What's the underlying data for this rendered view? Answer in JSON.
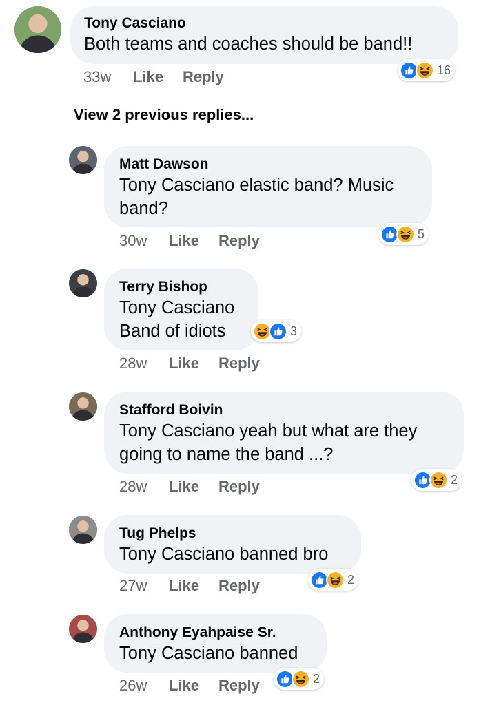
{
  "main_comment": {
    "author": "Tony Casciano",
    "text": "Both teams and coaches should be band!!",
    "time": "33w",
    "like_label": "Like",
    "reply_label": "Reply",
    "reaction_count": "16"
  },
  "view_previous": "View 2 previous replies...",
  "replies": [
    {
      "author": "Matt Dawson",
      "line1": "Tony Casciano elastic band? Music",
      "line2": "band?",
      "time": "30w",
      "like_label": "Like",
      "reply_label": "Reply",
      "reaction_count": "5"
    },
    {
      "author": "Terry Bishop",
      "line1": "Tony Casciano",
      "line2": "Band of idiots",
      "time": "28w",
      "like_label": "Like",
      "reply_label": "Reply",
      "reaction_count": "3"
    },
    {
      "author": "Stafford Boivin",
      "line1": "Tony Casciano  yeah but what are they",
      "line2": "going to name the band ...?",
      "time": "28w",
      "like_label": "Like",
      "reply_label": "Reply",
      "reaction_count": "2"
    },
    {
      "author": "Tug Phelps",
      "line1": "Tony Casciano banned bro",
      "time": "27w",
      "like_label": "Like",
      "reply_label": "Reply",
      "reaction_count": "2"
    },
    {
      "author": "Anthony Eyahpaise Sr.",
      "line1": "Tony Casciano banned",
      "time": "26w",
      "like_label": "Like",
      "reply_label": "Reply",
      "reaction_count": "2"
    }
  ],
  "colors": {
    "bubble": "#f0f2f5",
    "meta_text": "#65676b",
    "like_blue": "#1877f2",
    "haha_yellow": "#f7b125"
  },
  "icons": [
    "like-reaction-icon",
    "haha-reaction-icon",
    "avatar"
  ]
}
